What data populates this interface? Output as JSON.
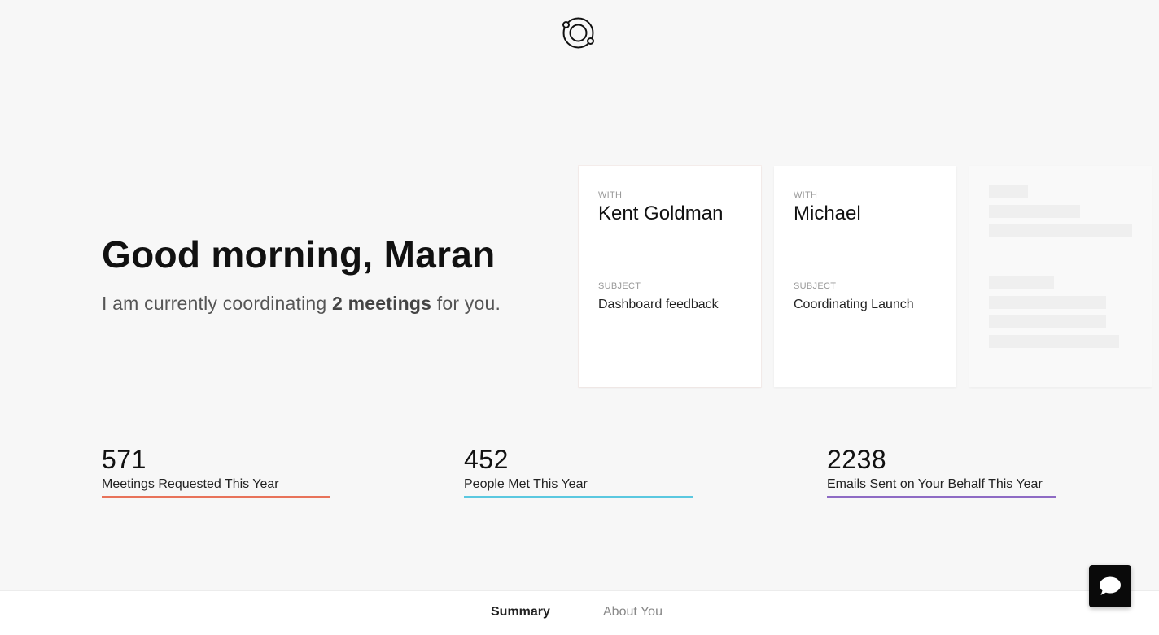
{
  "greeting": {
    "title": "Good morning, Maran",
    "sub_prefix": "I am currently coordinating ",
    "sub_bold": "2 meetings",
    "sub_suffix": " for you."
  },
  "meetings": [
    {
      "with_label": "WITH",
      "name": "Kent Goldman",
      "subject_label": "SUBJECT",
      "subject": "Dashboard feedback"
    },
    {
      "with_label": "WITH",
      "name": "Michael",
      "subject_label": "SUBJECT",
      "subject": "Coordinating Launch"
    }
  ],
  "stats": [
    {
      "value": "571",
      "label": "Meetings Requested This Year",
      "color": "#e8735a"
    },
    {
      "value": "452",
      "label": "People Met This Year",
      "color": "#5bc8e0"
    },
    {
      "value": "2238",
      "label": "Emails Sent on Your Behalf This Year",
      "color": "#8e6bc4"
    }
  ],
  "footer": {
    "tabs": [
      {
        "label": "Summary",
        "active": true
      },
      {
        "label": "About You",
        "active": false
      }
    ]
  },
  "icons": {
    "logo": "orbit-logo-icon",
    "chat": "chat-bubble-icon"
  }
}
